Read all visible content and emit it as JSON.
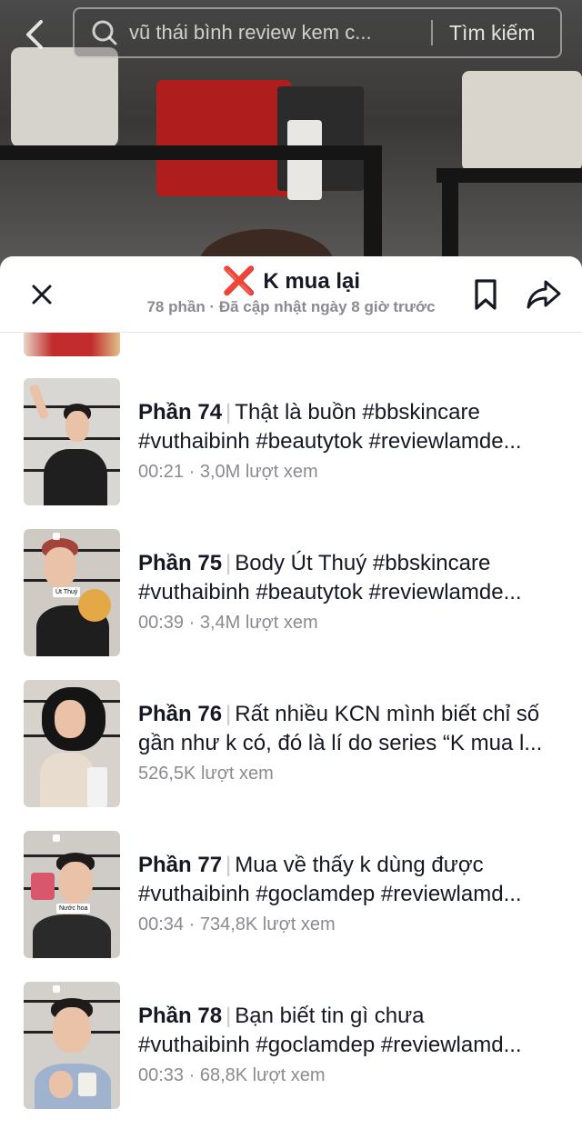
{
  "search": {
    "query": "vũ thái bình review kem c...",
    "button_label": "Tìm kiếm"
  },
  "playlist": {
    "title_icon": "❌",
    "title": "K mua lại",
    "subtitle": "78 phần · Đã cập nhật ngày 8 giờ trước"
  },
  "items": [
    {
      "part": "Phần 74",
      "line1": "Thật là buồn #bbskincare",
      "line2": "#vuthaibinh #beautytok #reviewlamde...",
      "meta": "00:21 · 3,0M lượt xem"
    },
    {
      "part": "Phần 75",
      "line1": "Body Út Thuý #bbskincare",
      "line2": "#vuthaibinh #beautytok #reviewlamde...",
      "meta": "00:39 · 3,4M lượt xem",
      "thumb_tag": "Út Thuý"
    },
    {
      "part": "Phần 76",
      "line1": "Rất nhiều KCN mình biết chỉ số",
      "line2": "gần như k có, đó là lí do series “K mua l...",
      "meta": "526,5K lượt xem"
    },
    {
      "part": "Phần 77",
      "line1": "Mua về thấy k dùng được",
      "line2": "#vuthaibinh #goclamdep #reviewlamd...",
      "meta": "00:34 · 734,8K lượt xem",
      "thumb_tag": "Nước hoa"
    },
    {
      "part": "Phần 78",
      "line1": "Bạn biết tin gì chưa",
      "line2": "#vuthaibinh #goclamdep #reviewlamd...",
      "meta": "00:33 · 68,8K lượt xem"
    }
  ]
}
